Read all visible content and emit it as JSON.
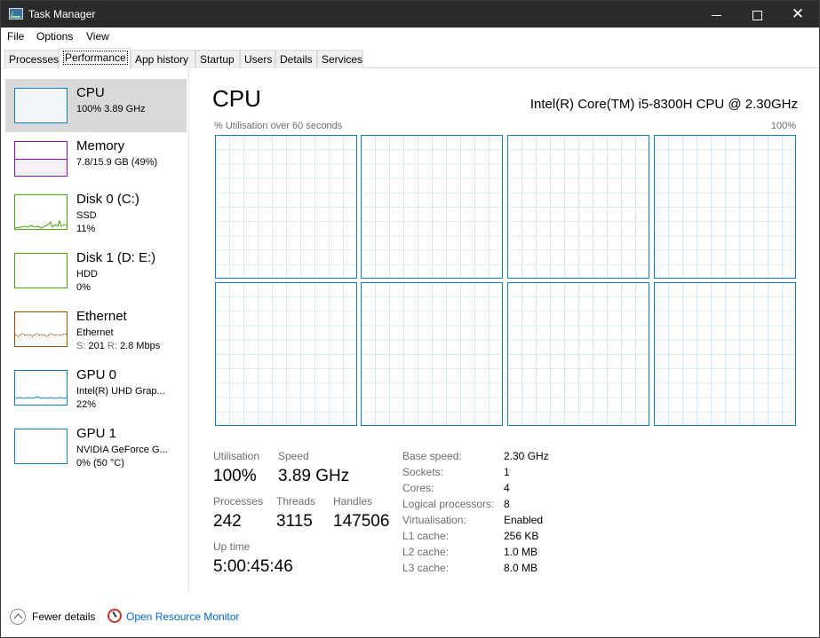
{
  "window": {
    "title": "Task Manager"
  },
  "menu": [
    "File",
    "Options",
    "View"
  ],
  "tabs": [
    "Processes",
    "Performance",
    "App history",
    "Startup",
    "Users",
    "Details",
    "Services"
  ],
  "active_tab": "Performance",
  "sidebar": {
    "items": [
      {
        "name": "CPU",
        "line2": "100%  3.89 GHz",
        "line3": "",
        "color": "#117dbb",
        "selected": true
      },
      {
        "name": "Memory",
        "line2": "7.8/15.9 GB (49%)",
        "line3": "",
        "color": "#8b12ae",
        "selected": false
      },
      {
        "name": "Disk 0 (C:)",
        "line2": "SSD",
        "line3": "11%",
        "color": "#4da60c",
        "selected": false
      },
      {
        "name": "Disk 1 (D: E:)",
        "line2": "HDD",
        "line3": "0%",
        "color": "#4da60c",
        "selected": false
      },
      {
        "name": "Ethernet",
        "line2": "Ethernet",
        "line3_send_label": "S:",
        "line3_send": "201",
        "line3_recv_label": "R:",
        "line3_recv": "2.8 Mbps",
        "color": "#a74f01",
        "selected": false
      },
      {
        "name": "GPU 0",
        "line2": "Intel(R) UHD Grap...",
        "line3": "22%",
        "color": "#117dbb",
        "selected": false
      },
      {
        "name": "GPU 1",
        "line2": "NVIDIA GeForce G...",
        "line3": "0%  (50 °C)",
        "color": "#117dbb",
        "selected": false
      }
    ]
  },
  "main": {
    "title": "CPU",
    "model": "Intel(R) Core(TM) i5-8300H CPU @ 2.30GHz",
    "graph_label": "% Utilisation over 60 seconds",
    "graph_max": "100%",
    "logical_processor_graphs": 8,
    "stats": {
      "utilisation_label": "Utilisation",
      "utilisation": "100%",
      "speed_label": "Speed",
      "speed": "3.89 GHz",
      "processes_label": "Processes",
      "processes": "242",
      "threads_label": "Threads",
      "threads": "3115",
      "handles_label": "Handles",
      "handles": "147506",
      "uptime_label": "Up time",
      "uptime": "5:00:45:46"
    },
    "specs": [
      {
        "label": "Base speed:",
        "value": "2.30 GHz"
      },
      {
        "label": "Sockets:",
        "value": "1"
      },
      {
        "label": "Cores:",
        "value": "4"
      },
      {
        "label": "Logical processors:",
        "value": "8"
      },
      {
        "label": "Virtualisation:",
        "value": "Enabled"
      },
      {
        "label": "L1 cache:",
        "value": "256 KB"
      },
      {
        "label": "L2 cache:",
        "value": "1.0 MB"
      },
      {
        "label": "L3 cache:",
        "value": "8.0 MB"
      }
    ]
  },
  "footer": {
    "fewer_details": "Fewer details",
    "open_resource_monitor": "Open Resource Monitor"
  },
  "icons": [
    "task-manager-icon",
    "minimize-icon",
    "maximize-icon",
    "close-icon",
    "chevron-up-icon",
    "resource-monitor-icon"
  ]
}
